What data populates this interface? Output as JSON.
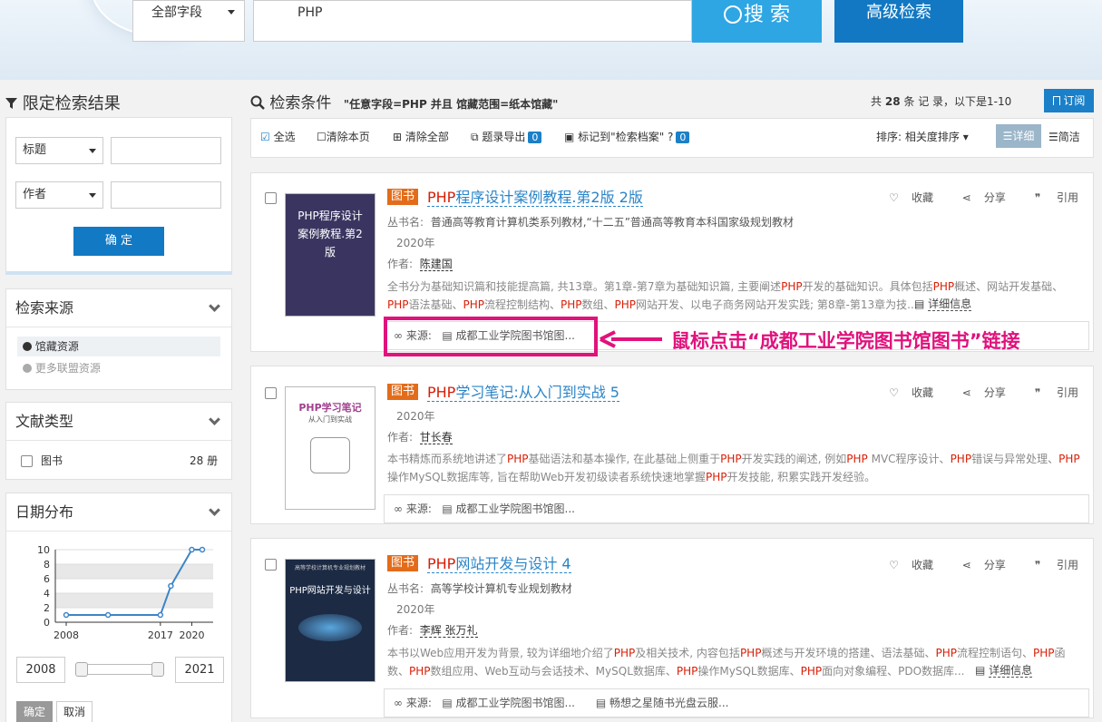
{
  "search": {
    "field": "全部字段",
    "query": "PHP",
    "search_label": "搜 索",
    "advanced_label": "高级检索"
  },
  "sidebar": {
    "refine_title": "限定检索结果",
    "filter1_field": "标题",
    "filter2_field": "作者",
    "confirm_label": "确 定",
    "source_title": "检索来源",
    "source_items": [
      "馆藏资源",
      "更多联盟资源"
    ],
    "doctype_title": "文献类型",
    "doctype_item": "图书",
    "doctype_count": "28",
    "doctype_unit": "册",
    "date_title": "日期分布",
    "date_from": "2008",
    "date_to": "2021",
    "ok_label": "确定",
    "cancel_label": "取消"
  },
  "chart_data": {
    "type": "line",
    "x": [
      2008,
      2012,
      2017,
      2018,
      2020,
      2021
    ],
    "y": [
      1,
      1,
      1,
      5,
      10,
      10
    ],
    "xticks": [
      "2008",
      "2017",
      "2020"
    ],
    "yticks": [
      "0",
      "2",
      "4",
      "6",
      "8",
      "10"
    ],
    "ylim": [
      0,
      10
    ],
    "color": "#3d85c6"
  },
  "results_header": {
    "title": "检索条件",
    "conditions": "\"任意字段=PHP 并且 馆藏范围=纸本馆藏\"",
    "count_prefix": "共",
    "count": "28",
    "count_suffix": "条 记 录，以下是1-10",
    "subscribe_label": "订阅"
  },
  "toolbar": {
    "select_all": "全选",
    "clear_page": "清除本页",
    "clear_all": "清除全部",
    "export": "题录导出",
    "export_count": "0",
    "mark": "标记到\"检索档案\"",
    "mark_count": "0",
    "sort_label": "排序:",
    "sort_value": "相关度排序",
    "view_detail": "详细",
    "view_simple": "简洁"
  },
  "labels": {
    "series_label": "丛书名:",
    "author_label": "作者:",
    "source_label": "来源:",
    "detail_info": "详细信息",
    "collect": "收藏",
    "share": "分享",
    "cite": "引用"
  },
  "results": [
    {
      "tag": "图书",
      "title_hl": "PHP",
      "title_rest": "程序设计案例教程.第2版  2版",
      "cover_text": "PHP程序设计案例教程.第2版",
      "series": "普通高等教育计算机类系列教材,“十二五”普通高等教育本科国家级规划教材",
      "year": "2020年",
      "author": "陈建国",
      "abstract_segments": [
        "全书分为基础知识篇和技能提高篇, 共13章。第1章-第7章为基础知识篇, 主要阐述",
        "PHP",
        "开发的基础知识。具体包括",
        "PHP",
        "概述、网站开发基础、",
        "PHP",
        "语法基础、",
        "PHP",
        "流程控制结构、",
        "PHP",
        "数组、",
        "PHP",
        "网站开发、以电子商务网站开发实践; 第8章-第13章为技..."
      ],
      "source": "成都工业学院图书馆图..."
    },
    {
      "tag": "图书",
      "title_hl": "PHP",
      "title_rest": "学习笔记:从入门到实战  5",
      "cover_text": "PHP学习笔记",
      "cover_sub": "从入门到实战",
      "year": "2020年",
      "author": "甘长春",
      "abstract_segments": [
        "本书精炼而系统地讲述了",
        "PHP",
        "基础语法和基本操作, 在此基础上侧重于",
        "PHP",
        "开发实践的阐述, 例如",
        "PHP",
        " MVC程序设计、",
        "PHP",
        "错误与异常处理、",
        "PHP",
        "操作MySQL数据库等, 旨在帮助Web开发初级读者系统快速地掌握",
        "PHP",
        "开发技能, 积累实践开发经验。"
      ],
      "source": "成都工业学院图书馆图..."
    },
    {
      "tag": "图书",
      "title_hl": "PHP",
      "title_rest": "网站开发与设计  4",
      "cover_text": "PHP网站开发与设计",
      "cover_top": "高等学校计算机专业规划教材",
      "series": "高等学校计算机专业规划教材",
      "year": "2020年",
      "author": "李辉 张万礼",
      "abstract_segments": [
        "本书以Web应用开发为背景, 较为详细地介绍了",
        "PHP",
        "及相关技术, 内容包括",
        "PHP",
        "概述与开发环境的搭建、语法基础、",
        "PHP",
        "流程控制语句、",
        "PHP",
        "函数、",
        "PHP",
        "数组应用、Web互动与会话技术、MySQL数据库、",
        "PHP",
        "操作MySQL数据库、",
        "PHP",
        "面向对象编程、PDO数据库..."
      ],
      "source": "成都工业学院图书馆图...",
      "source2": "畅想之星随书光盘云服..."
    }
  ],
  "annotation": {
    "text": "鼠标点击“成都工业学院图书馆图书”链接",
    "color": "#e0127c"
  }
}
